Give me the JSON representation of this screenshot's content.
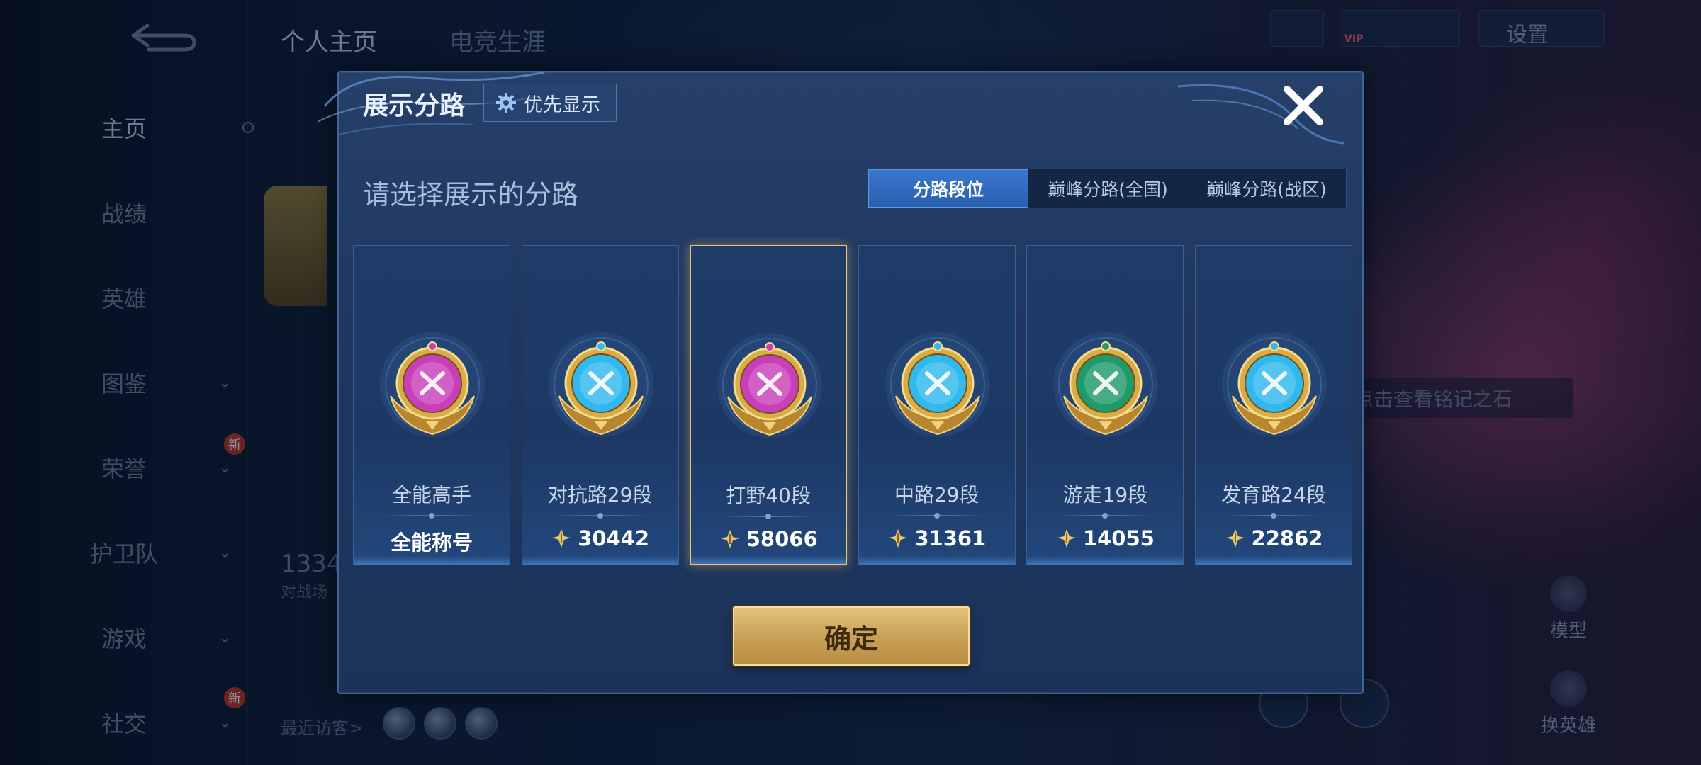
{
  "background": {
    "top_tabs": [
      "个人主页",
      "电竞生涯"
    ],
    "nav_items": [
      {
        "label": "主页",
        "active": true
      },
      {
        "label": "战绩",
        "active": false
      },
      {
        "label": "英雄",
        "active": false
      },
      {
        "label": "图鉴",
        "active": false
      },
      {
        "label": "荣誉",
        "active": false
      },
      {
        "label": "护卫队",
        "active": false
      },
      {
        "label": "游戏",
        "active": false
      },
      {
        "label": "社交",
        "active": false
      }
    ],
    "new_badge": "新",
    "settings_label": "设置",
    "vip_label": "VIP",
    "stat_number": "1334",
    "stat_sub": "对战场",
    "recent_visitors": "最近访客>",
    "rune_hint": "点击查看铭记之石",
    "side_buttons": [
      "模型",
      "换英雄"
    ]
  },
  "modal": {
    "title": "展示分路",
    "priority_button": "优先显示",
    "subheading": "请选择展示的分路",
    "tabs": [
      {
        "label": "分路段位",
        "active": true
      },
      {
        "label": "巅峰分路(全国)",
        "active": false
      },
      {
        "label": "巅峰分路(战区)",
        "active": false
      }
    ],
    "cards": [
      {
        "name": "全能高手",
        "value": "全能称号",
        "has_power_icon": false,
        "selected": false,
        "emblem": "allround-emblem-icon",
        "color": "#c83fb9"
      },
      {
        "name": "对抗路29段",
        "value": "30442",
        "has_power_icon": true,
        "selected": false,
        "emblem": "clash-lane-emblem-icon",
        "color": "#2fb9ee"
      },
      {
        "name": "打野40段",
        "value": "58066",
        "has_power_icon": true,
        "selected": true,
        "emblem": "jungle-emblem-icon",
        "color": "#c83fb9"
      },
      {
        "name": "中路29段",
        "value": "31361",
        "has_power_icon": true,
        "selected": false,
        "emblem": "mid-lane-emblem-icon",
        "color": "#2fb9ee"
      },
      {
        "name": "游走19段",
        "value": "14055",
        "has_power_icon": true,
        "selected": false,
        "emblem": "roam-emblem-icon",
        "color": "#1f9a6a"
      },
      {
        "name": "发育路24段",
        "value": "22862",
        "has_power_icon": true,
        "selected": false,
        "emblem": "farm-lane-emblem-icon",
        "color": "#2fb9ee"
      }
    ],
    "confirm_button": "确定"
  }
}
